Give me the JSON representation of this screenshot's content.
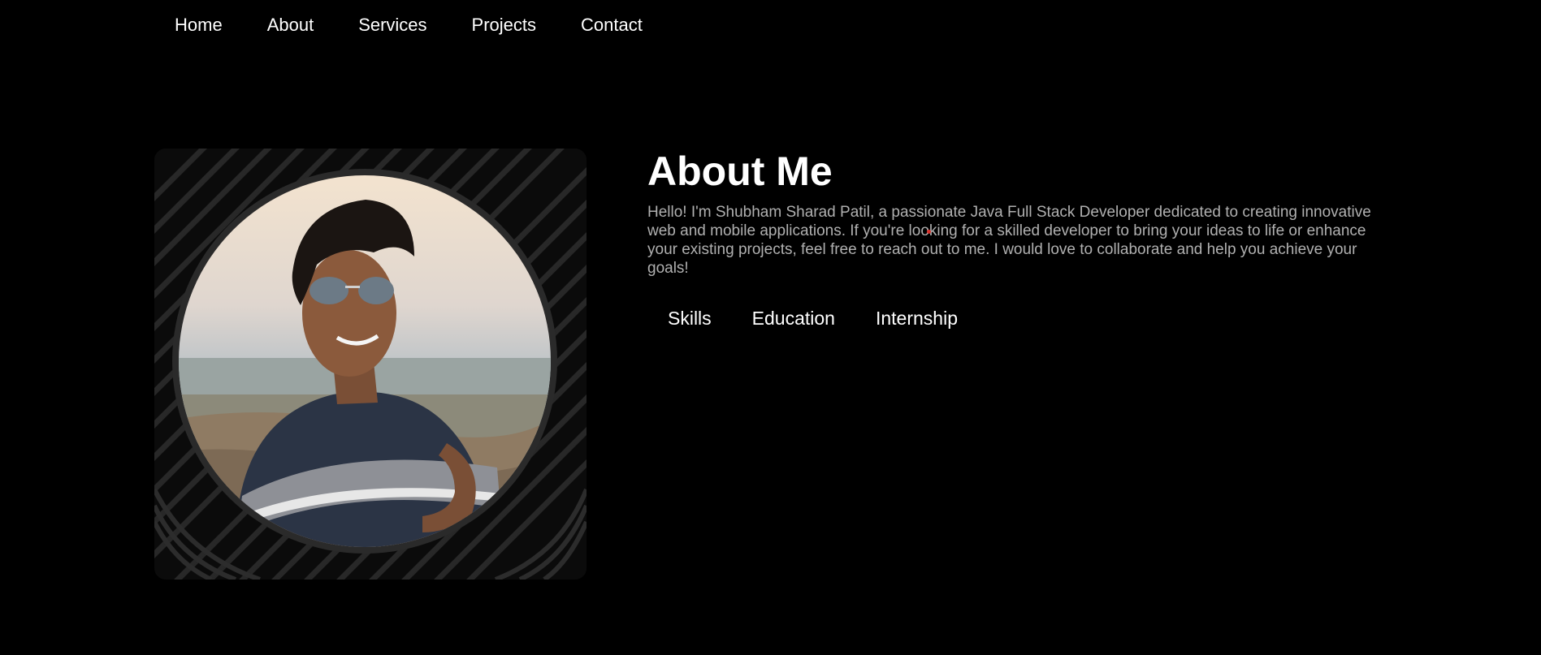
{
  "nav": {
    "items": [
      {
        "label": "Home"
      },
      {
        "label": "About"
      },
      {
        "label": "Services"
      },
      {
        "label": "Projects"
      },
      {
        "label": "Contact"
      }
    ]
  },
  "about": {
    "title": "About Me",
    "text": "Hello! I'm Shubham Sharad Patil, a passionate Java Full Stack Developer dedicated to creating innovative web and mobile applications. If you're looking for a skilled developer to bring your ideas to life or enhance your existing projects, feel free to reach out to me. I would love to collaborate and help you achieve your goals!",
    "tabs": [
      {
        "label": "Skills"
      },
      {
        "label": "Education"
      },
      {
        "label": "Internship"
      }
    ]
  },
  "colors": {
    "background": "#000000",
    "text": "#ffffff",
    "muted_text": "#b0b0b0",
    "cursor_accent": "#d9302a"
  }
}
